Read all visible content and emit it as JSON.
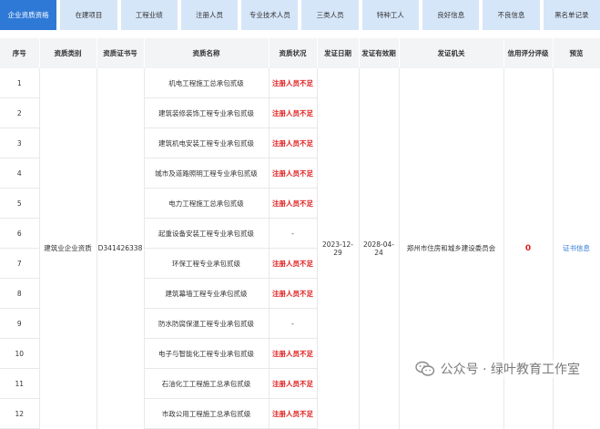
{
  "tabs": [
    {
      "label": "企业资质资格",
      "active": true
    },
    {
      "label": "在建项目",
      "active": false
    },
    {
      "label": "工程业绩",
      "active": false
    },
    {
      "label": "注册人员",
      "active": false
    },
    {
      "label": "专业技术人员",
      "active": false
    },
    {
      "label": "三类人员",
      "active": false
    },
    {
      "label": "特种工人",
      "active": false
    },
    {
      "label": "良好信息",
      "active": false
    },
    {
      "label": "不良信息",
      "active": false
    },
    {
      "label": "黑名单记录",
      "active": false
    }
  ],
  "table": {
    "headers": [
      "序号",
      "资质类别",
      "资质证书号",
      "资质名称",
      "资质状况",
      "发证日期",
      "发证有效期",
      "发证机关",
      "信用评分评级",
      "预览"
    ],
    "merged": {
      "category": "建筑业企业资质",
      "cert_no": "D341426338",
      "issue_date": "2023-12-29",
      "valid_until": "2028-04-24",
      "authority": "郑州市住房和城乡建设委员会",
      "score": "0",
      "preview": "证书信息"
    },
    "rows": [
      {
        "no": "1",
        "name": "机电工程施工总承包贰级",
        "status": "注册人员不足"
      },
      {
        "no": "2",
        "name": "建筑装修装饰工程专业承包贰级",
        "status": "注册人员不足"
      },
      {
        "no": "3",
        "name": "建筑机电安装工程专业承包贰级",
        "status": "注册人员不足"
      },
      {
        "no": "4",
        "name": "城市及道路照明工程专业承包贰级",
        "status": "注册人员不足"
      },
      {
        "no": "5",
        "name": "电力工程施工总承包贰级",
        "status": "注册人员不足"
      },
      {
        "no": "6",
        "name": "起重设备安装工程专业承包贰级",
        "status": "-"
      },
      {
        "no": "7",
        "name": "环保工程专业承包贰级",
        "status": "注册人员不足"
      },
      {
        "no": "8",
        "name": "建筑幕墙工程专业承包贰级",
        "status": "注册人员不足"
      },
      {
        "no": "9",
        "name": "防水防腐保温工程专业承包贰级",
        "status": "-"
      },
      {
        "no": "10",
        "name": "电子与智能化工程专业承包贰级",
        "status": "注册人员不足"
      },
      {
        "no": "11",
        "name": "石油化工工程施工总承包贰级",
        "status": "注册人员不足"
      },
      {
        "no": "12",
        "name": "市政公用工程施工总承包贰级",
        "status": "注册人员不足"
      }
    ]
  },
  "watermark": {
    "text": "公众号 · 绿叶教育工作室",
    "icon": "wechat-icon"
  },
  "colors": {
    "tab_active": "#2f79d6",
    "tab_inactive": "#d6e6f9",
    "warning": "#e02020",
    "link": "#2f79d6"
  }
}
